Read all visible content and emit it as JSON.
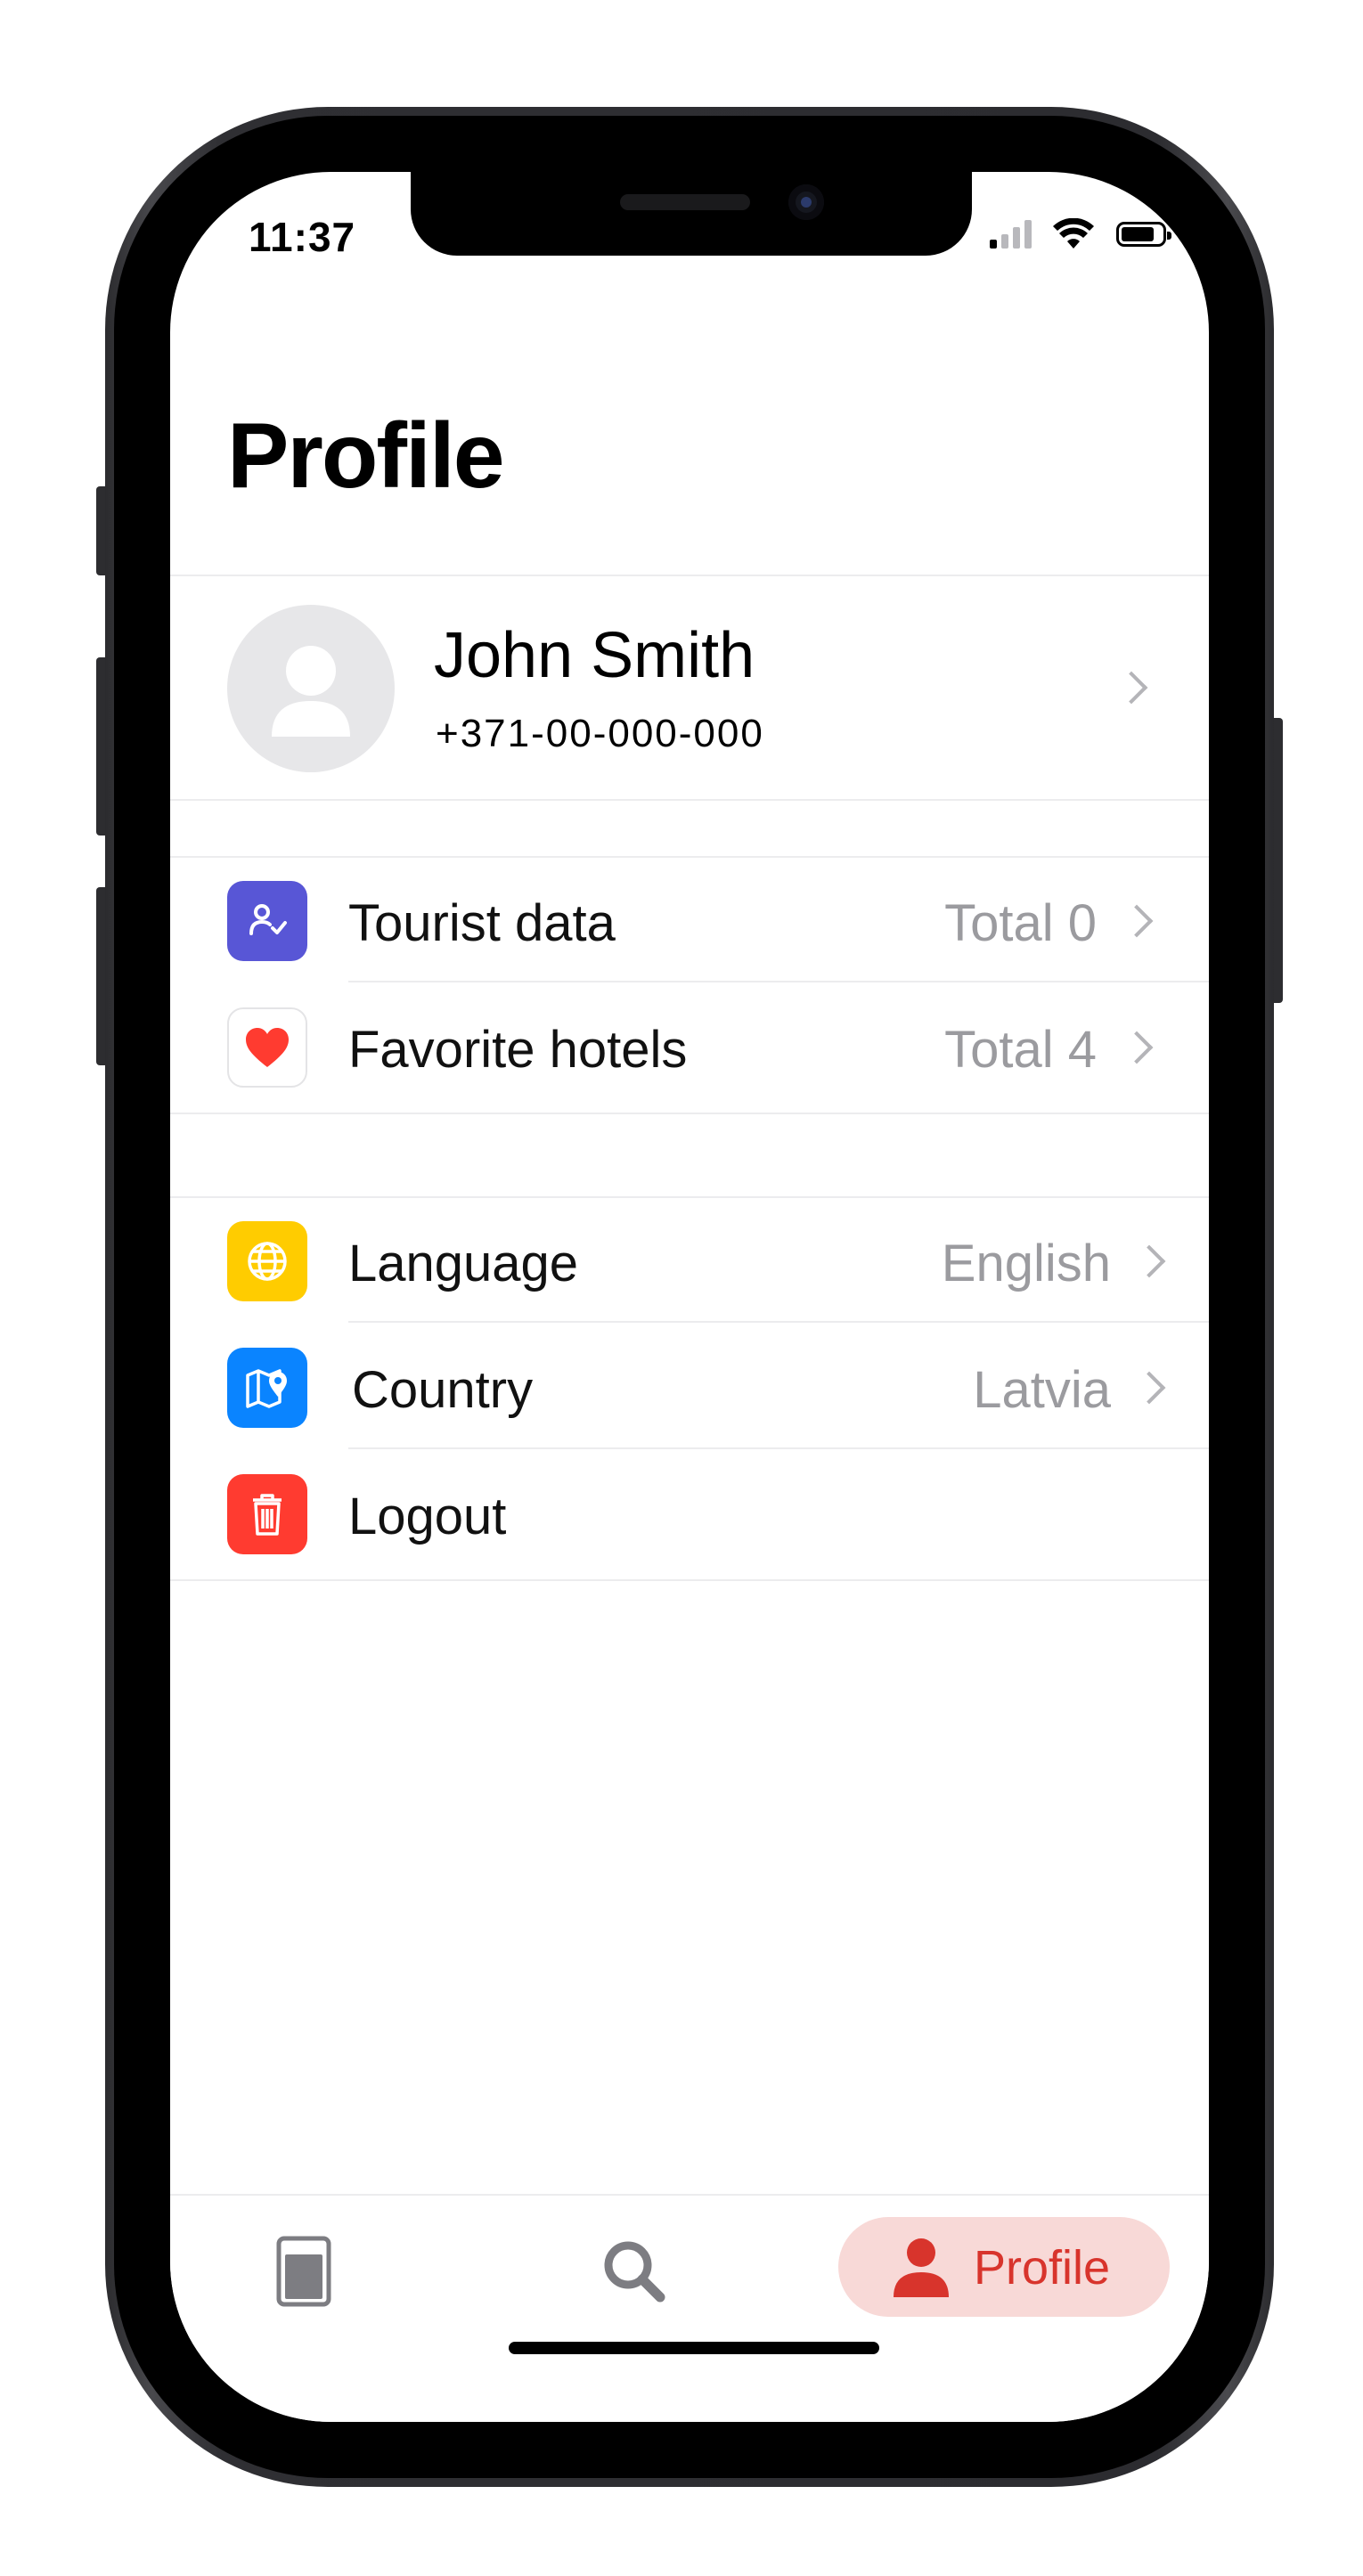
{
  "status_bar": {
    "time": "11:37"
  },
  "header": {
    "title": "Profile"
  },
  "profile_card": {
    "name": "John Smith",
    "phone": "+371-00-000-000"
  },
  "sections": [
    {
      "items": [
        {
          "label": "Tourist data",
          "value": "Total 0",
          "icon": "tourist-data-icon",
          "icon_color": "#5856d6"
        },
        {
          "label": "Favorite hotels",
          "value": "Total 4",
          "icon": "heart-icon",
          "icon_color": "#ff3b30"
        }
      ]
    },
    {
      "items": [
        {
          "label": "Language",
          "value": "English",
          "icon": "globe-icon",
          "icon_color": "#ffcc00"
        },
        {
          "label": "Country",
          "value": "Latvia",
          "icon": "map-pin-icon",
          "icon_color": "#0a84ff"
        },
        {
          "label": "Logout",
          "value": "",
          "icon": "trash-icon",
          "icon_color": "#ff3b30"
        }
      ]
    }
  ],
  "tab_bar": {
    "tabs": [
      {
        "icon": "bookings-icon",
        "label": ""
      },
      {
        "icon": "search-icon",
        "label": ""
      },
      {
        "icon": "person-icon",
        "label": "Profile",
        "active": true
      }
    ],
    "active_color": "#d8342c",
    "active_background": "#f8d9d7"
  }
}
